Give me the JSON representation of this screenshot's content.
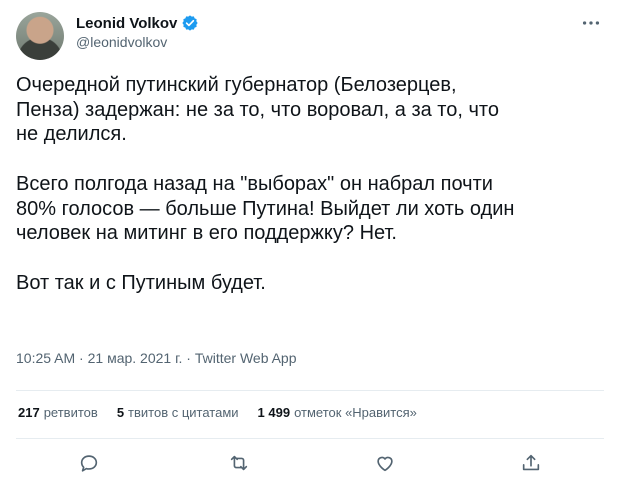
{
  "author": {
    "display_name": "Leonid Volkov",
    "handle": "@leonidvolkov",
    "verified_icon": "verified-badge-icon",
    "accent_color": "#1d9bf0"
  },
  "tweet": {
    "paragraphs": [
      "Очередной путинский губернатор (Белозерцев,\nПенза) задержан: не за то, что воровал, а за то, что\nне делился.",
      "Всего полгода назад на \"выборах\" он набрал почти\n80% голосов — больше Путина! Выйдет ли хоть один\nчеловек на митинг в его поддержку? Нет.",
      "Вот так и с Путиным будет."
    ]
  },
  "meta": {
    "time": "10:25 AM",
    "separator": " · ",
    "date": "21 мар. 2021 г.",
    "source": "Twitter Web App"
  },
  "stats": {
    "retweets_count": "217",
    "retweets_label": "ретвитов",
    "quotes_count": "5",
    "quotes_label": "твитов с цитатами",
    "likes_count": "1 499",
    "likes_label": "отметок «Нравится»"
  },
  "actions": {
    "icons": [
      "reply-icon",
      "retweet-icon",
      "like-icon",
      "share-icon"
    ]
  }
}
